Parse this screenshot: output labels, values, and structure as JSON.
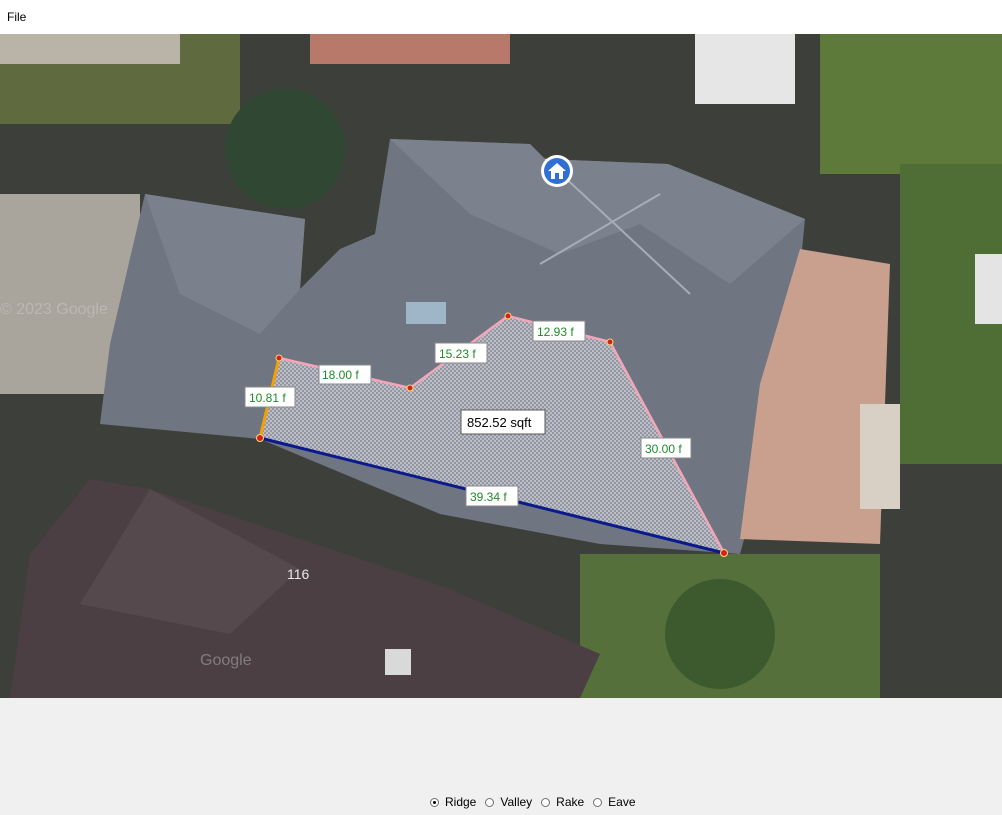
{
  "menu": {
    "file": "File"
  },
  "map": {
    "house_number": "116",
    "watermark_left": "© 2023 Google",
    "watermark_bottom": "Google",
    "area_label": "852.52 sqft",
    "segments": [
      {
        "label": "10.81 f",
        "type": "orange"
      },
      {
        "label": "18.00 f",
        "type": "pink"
      },
      {
        "label": "15.23 f",
        "type": "pink"
      },
      {
        "label": "12.93 f",
        "type": "pink"
      },
      {
        "label": "30.00 f",
        "type": "pink"
      },
      {
        "label": "39.34 f",
        "type": "blue"
      }
    ]
  },
  "edge_types": {
    "selected": "Ridge",
    "options": [
      "Ridge",
      "Valley",
      "Rake",
      "Eave"
    ]
  }
}
